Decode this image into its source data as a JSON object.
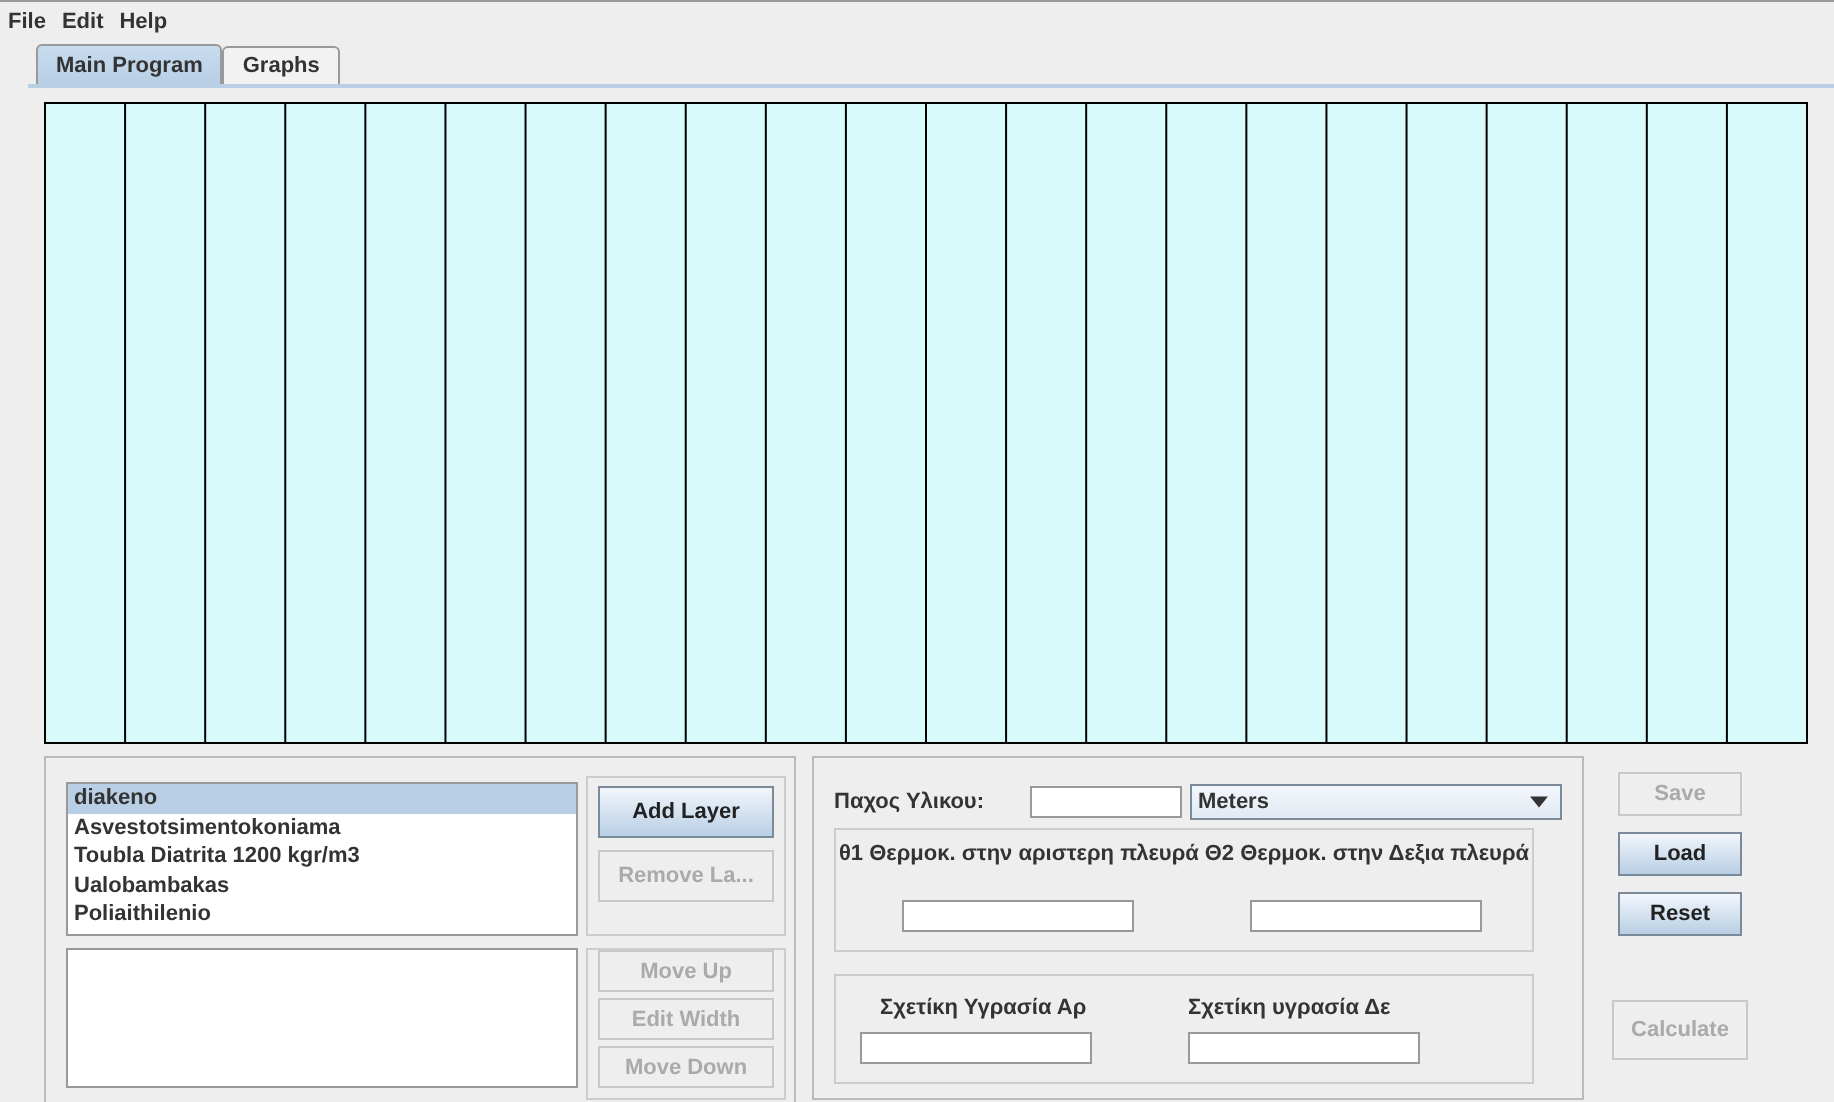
{
  "menu": [
    "File",
    "Edit",
    "Help"
  ],
  "tabs": [
    {
      "label": "Main Program",
      "selected": true
    },
    {
      "label": "Graphs",
      "selected": false
    }
  ],
  "layers": {
    "items": [
      {
        "label": "diakeno",
        "selected": true
      },
      {
        "label": "Asvestotsimentokoniama",
        "selected": false
      },
      {
        "label": "Toubla Diatrita  1200 kgr/m3",
        "selected": false
      },
      {
        "label": "Ualobambakas",
        "selected": false
      },
      {
        "label": "Poliaithilenio",
        "selected": false
      }
    ]
  },
  "layer_buttons": [
    {
      "label": "Add Layer",
      "disabled": false
    },
    {
      "label": "Remove La...",
      "disabled": true
    }
  ],
  "move_buttons": [
    {
      "label": "Move Up",
      "disabled": true
    },
    {
      "label": "Edit Width",
      "disabled": true
    },
    {
      "label": "Move Down",
      "disabled": true
    }
  ],
  "thickness": {
    "label": "Παχος Υλικου:",
    "unit": "Meters"
  },
  "temperatures": [
    {
      "label": "θ1 Θερμοκ. στην αριστερη πλευρά"
    },
    {
      "label": "Θ2 Θερμοκ. στην Δεξια πλευρά"
    }
  ],
  "humidity": [
    {
      "label": "Σχετίκη Υγρασία Αρ"
    },
    {
      "label": "Σχετίκη υγρασία Δε"
    }
  ],
  "file_buttons": [
    {
      "label": "Save",
      "disabled": true
    },
    {
      "label": "Load",
      "disabled": false
    },
    {
      "label": "Reset",
      "disabled": false
    }
  ],
  "calculate": {
    "label": "Calculate",
    "disabled": true
  }
}
